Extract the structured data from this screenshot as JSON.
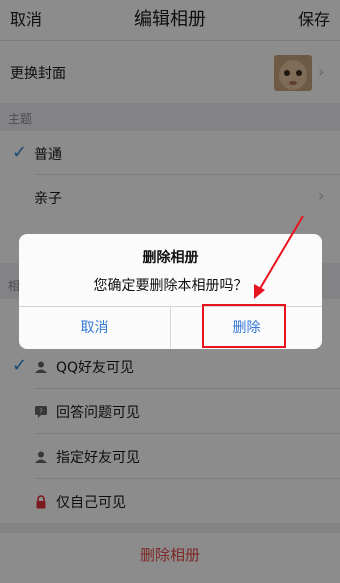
{
  "header": {
    "cancel": "取消",
    "title": "编辑相册",
    "save": "保存"
  },
  "cover": {
    "label": "更换封面"
  },
  "theme": {
    "section": "主题",
    "items": [
      {
        "label": "普通",
        "checked": true
      },
      {
        "label": "亲子",
        "checked": false
      }
    ]
  },
  "privacy": {
    "section_partial": "相",
    "items": [
      {
        "label": "QQ好友可见",
        "checked": true,
        "icon": "person-icon"
      },
      {
        "label": "回答问题可见",
        "checked": false,
        "icon": "question-bubble-icon"
      },
      {
        "label": "指定好友可见",
        "checked": false,
        "icon": "person-icon"
      },
      {
        "label": "仅自己可见",
        "checked": false,
        "icon": "lock-icon"
      }
    ]
  },
  "bottom": {
    "delete_album": "删除相册"
  },
  "dialog": {
    "title": "删除相册",
    "message": "您确定要删除本相册吗？",
    "cancel": "取消",
    "confirm": "删除"
  },
  "colors": {
    "accent": "#2d88d8",
    "danger": "#e64a4a",
    "annotation": "#e8131f",
    "lock": "#e0303a"
  }
}
